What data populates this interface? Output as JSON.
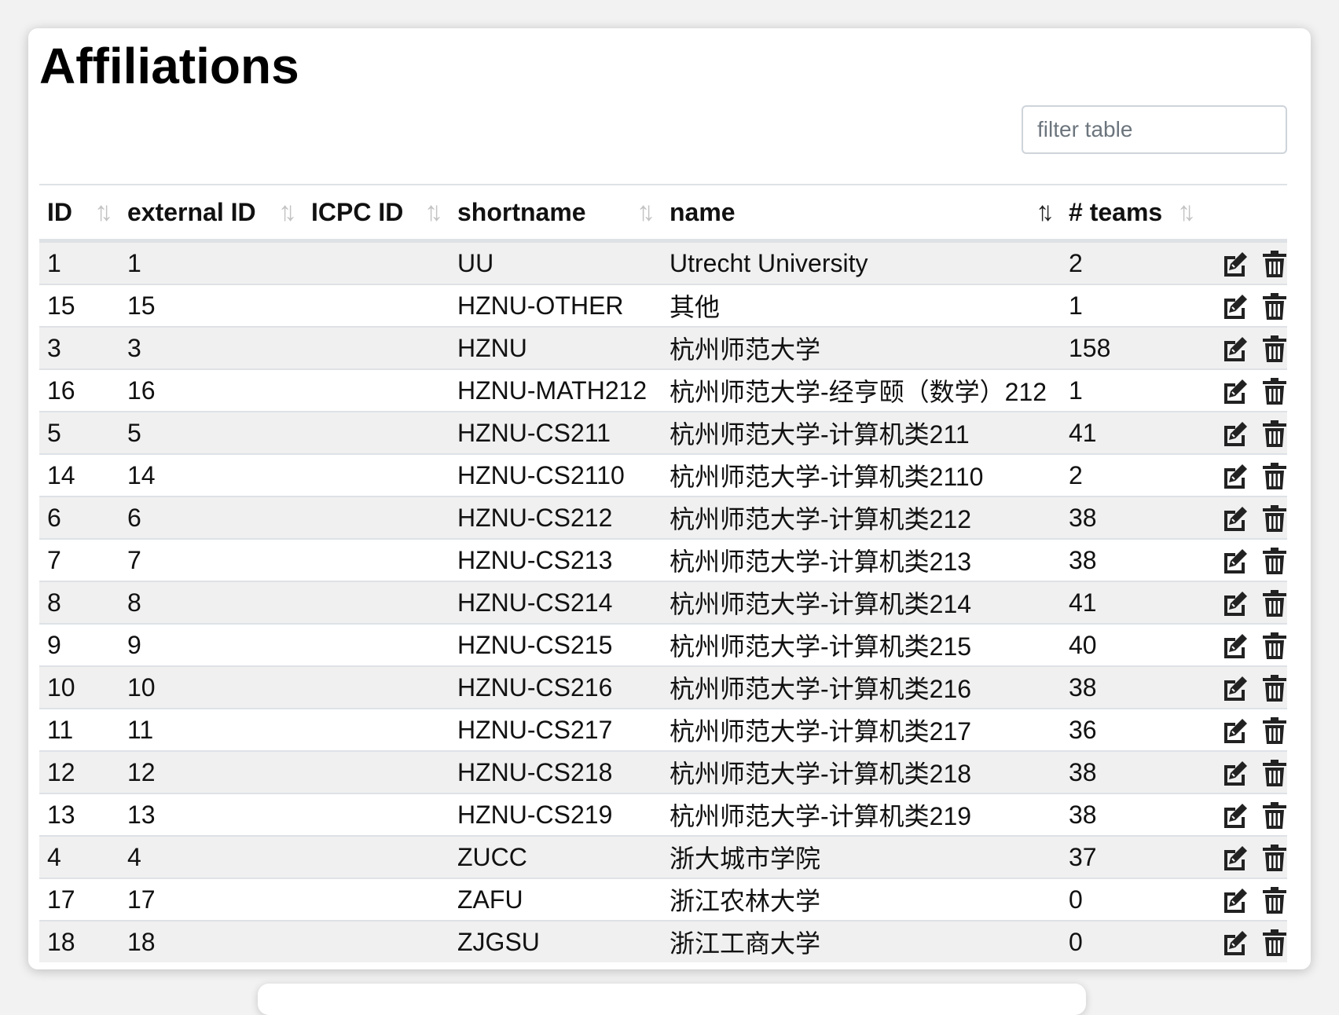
{
  "page": {
    "title": "Affiliations"
  },
  "filter": {
    "placeholder": "filter table",
    "value": ""
  },
  "columns": [
    {
      "label": "ID",
      "sort": "none"
    },
    {
      "label": "external ID",
      "sort": "none"
    },
    {
      "label": "ICPC ID",
      "sort": "none"
    },
    {
      "label": "shortname",
      "sort": "none"
    },
    {
      "label": "name",
      "sort": "active"
    },
    {
      "label": "# teams",
      "sort": "none"
    }
  ],
  "icons": {
    "sort": "sort-arrows-icon",
    "edit": "edit-icon",
    "delete": "trash-icon"
  },
  "rows": [
    {
      "id": "1",
      "external_id": "1",
      "icpc_id": "",
      "shortname": "UU",
      "name": "Utrecht University",
      "teams": "2"
    },
    {
      "id": "15",
      "external_id": "15",
      "icpc_id": "",
      "shortname": "HZNU-OTHER",
      "name": "其他",
      "teams": "1"
    },
    {
      "id": "3",
      "external_id": "3",
      "icpc_id": "",
      "shortname": "HZNU",
      "name": "杭州师范大学",
      "teams": "158"
    },
    {
      "id": "16",
      "external_id": "16",
      "icpc_id": "",
      "shortname": "HZNU-MATH212",
      "name": "杭州师范大学-经亨颐（数学）212",
      "teams": "1"
    },
    {
      "id": "5",
      "external_id": "5",
      "icpc_id": "",
      "shortname": "HZNU-CS211",
      "name": "杭州师范大学-计算机类211",
      "teams": "41"
    },
    {
      "id": "14",
      "external_id": "14",
      "icpc_id": "",
      "shortname": "HZNU-CS2110",
      "name": "杭州师范大学-计算机类2110",
      "teams": "2"
    },
    {
      "id": "6",
      "external_id": "6",
      "icpc_id": "",
      "shortname": "HZNU-CS212",
      "name": "杭州师范大学-计算机类212",
      "teams": "38"
    },
    {
      "id": "7",
      "external_id": "7",
      "icpc_id": "",
      "shortname": "HZNU-CS213",
      "name": "杭州师范大学-计算机类213",
      "teams": "38"
    },
    {
      "id": "8",
      "external_id": "8",
      "icpc_id": "",
      "shortname": "HZNU-CS214",
      "name": "杭州师范大学-计算机类214",
      "teams": "41"
    },
    {
      "id": "9",
      "external_id": "9",
      "icpc_id": "",
      "shortname": "HZNU-CS215",
      "name": "杭州师范大学-计算机类215",
      "teams": "40"
    },
    {
      "id": "10",
      "external_id": "10",
      "icpc_id": "",
      "shortname": "HZNU-CS216",
      "name": "杭州师范大学-计算机类216",
      "teams": "38"
    },
    {
      "id": "11",
      "external_id": "11",
      "icpc_id": "",
      "shortname": "HZNU-CS217",
      "name": "杭州师范大学-计算机类217",
      "teams": "36"
    },
    {
      "id": "12",
      "external_id": "12",
      "icpc_id": "",
      "shortname": "HZNU-CS218",
      "name": "杭州师范大学-计算机类218",
      "teams": "38"
    },
    {
      "id": "13",
      "external_id": "13",
      "icpc_id": "",
      "shortname": "HZNU-CS219",
      "name": "杭州师范大学-计算机类219",
      "teams": "38"
    },
    {
      "id": "4",
      "external_id": "4",
      "icpc_id": "",
      "shortname": "ZUCC",
      "name": "浙大城市学院",
      "teams": "37"
    },
    {
      "id": "17",
      "external_id": "17",
      "icpc_id": "",
      "shortname": "ZAFU",
      "name": "浙江农林大学",
      "teams": "0"
    },
    {
      "id": "18",
      "external_id": "18",
      "icpc_id": "",
      "shortname": "ZJGSU",
      "name": "浙江工商大学",
      "teams": "0"
    }
  ]
}
